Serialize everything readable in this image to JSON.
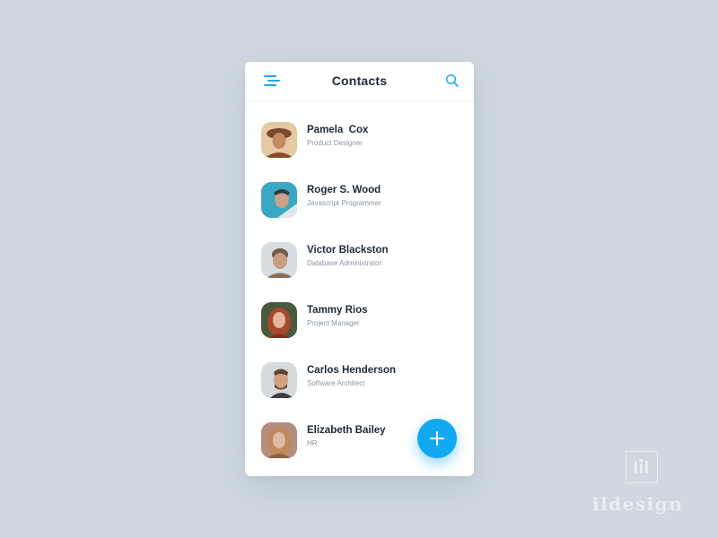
{
  "header": {
    "title": "Contacts",
    "menu_icon": "menu-icon",
    "search_icon": "search-icon",
    "accent": "#1ea7ec"
  },
  "contacts": [
    {
      "name": "Pamela  Cox",
      "role": "Product Designer",
      "avatar_colors": [
        "#e3c9a4",
        "#7a4a2c",
        "#c48a62",
        "#8c4b2b"
      ]
    },
    {
      "name": "Roger S. Wood",
      "role": "Javascript Programmer",
      "avatar_colors": [
        "#3ba7c4",
        "#dfe7ea",
        "#caa088",
        "#2c3e48"
      ]
    },
    {
      "name": "Victor Blackston",
      "role": "Database Administrator",
      "avatar_colors": [
        "#d8dde2",
        "#6f5a48",
        "#c99d80",
        "#8b6a52"
      ]
    },
    {
      "name": "Tammy Rios",
      "role": "Project Manager",
      "avatar_colors": [
        "#4b5a3d",
        "#a5482c",
        "#e4b59a",
        "#7c2f1e"
      ]
    },
    {
      "name": "Carlos Henderson",
      "role": "Software Architect",
      "avatar_colors": [
        "#d5dadd",
        "#3f3f44",
        "#d3a283",
        "#5a4632"
      ]
    },
    {
      "name": "Elizabeth Bailey",
      "role": "HR",
      "avatar_colors": [
        "#b58d7e",
        "#c18a5c",
        "#e2b9a4",
        "#8e5f45"
      ]
    }
  ],
  "fab": {
    "icon": "plus-icon",
    "color": "#12a8f2"
  },
  "watermark": {
    "text": "ildesign",
    "logo_text": "ılı"
  }
}
